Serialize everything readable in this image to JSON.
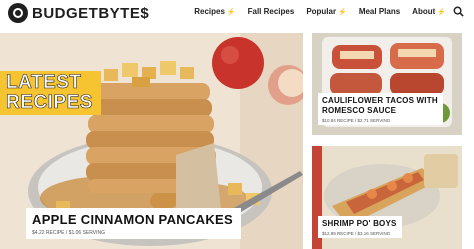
{
  "site": {
    "logo": "BUDGETBYTE$"
  },
  "nav": {
    "items": [
      {
        "label": "Recipes",
        "bolt": "⚡"
      },
      {
        "label": "Fall Recipes",
        "bolt": ""
      },
      {
        "label": "Popular",
        "bolt": "⚡"
      },
      {
        "label": "Meal Plans",
        "bolt": ""
      },
      {
        "label": "About",
        "bolt": "⚡"
      }
    ]
  },
  "hero": {
    "tag_line1": "LATEST",
    "tag_line2": "RECIPES",
    "title": "APPLE CINNAMON PANCAKES",
    "meta": "$4.22 RECIPE / $1.06 SERVING"
  },
  "cards": [
    {
      "title_line1": "CAULIFLOWER TACOS WITH",
      "title_line2": "ROMESCO SAUCE",
      "meta": "$10.84 RECIPE / $2.71 SERVING"
    },
    {
      "title_line1": "SHRIMP PO' BOYS",
      "title_line2": "",
      "meta": "$12.89 RECIPE / $3.16 SERVING"
    }
  ],
  "colors": {
    "accent": "#f7c431",
    "text": "#111111"
  },
  "icons": {
    "search": "search-icon",
    "logo": "coin-logo-icon"
  }
}
